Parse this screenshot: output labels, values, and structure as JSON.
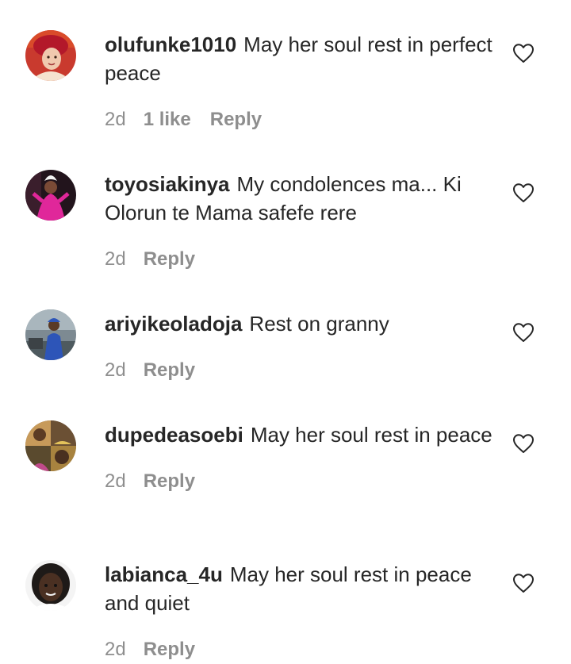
{
  "comments": [
    {
      "username": "olufunke1010",
      "text": "May her soul rest in perfect peace",
      "time": "2d",
      "likes": "1 like",
      "reply_label": "Reply",
      "avatar_icon": "avatar-photo",
      "like_icon": "heart-outline-icon",
      "avatar_colors": [
        "#d1322c",
        "#f2c9b0"
      ]
    },
    {
      "username": "toyosiakinya",
      "text": "My condolences ma... Ki Olorun te Mama safefe rere",
      "time": "2d",
      "reply_label": "Reply",
      "avatar_icon": "avatar-photo",
      "like_icon": "heart-outline-icon",
      "avatar_colors": [
        "#2a1a22",
        "#e0279a"
      ]
    },
    {
      "username": "ariyikeoladoja",
      "text": "Rest on granny",
      "time": "2d",
      "reply_label": "Reply",
      "avatar_icon": "avatar-photo",
      "like_icon": "heart-outline-icon",
      "avatar_colors": [
        "#6f7d86",
        "#2d55b8"
      ]
    },
    {
      "username": "dupedeasoebi",
      "text": "May her soul rest in peace",
      "time": "2d",
      "reply_label": "Reply",
      "avatar_icon": "avatar-photo",
      "like_icon": "heart-outline-icon",
      "avatar_colors": [
        "#7b5a3a",
        "#c79a5a"
      ]
    },
    {
      "username": "labianca_4u",
      "text": "May her soul rest in peace and quiet",
      "time": "2d",
      "reply_label": "Reply",
      "avatar_icon": "avatar-photo",
      "like_icon": "heart-outline-icon",
      "avatar_colors": [
        "#1e1a18",
        "#ffffff"
      ]
    }
  ],
  "colors": {
    "text_primary": "#262626",
    "text_secondary": "#8e8e8e",
    "background": "#ffffff"
  }
}
